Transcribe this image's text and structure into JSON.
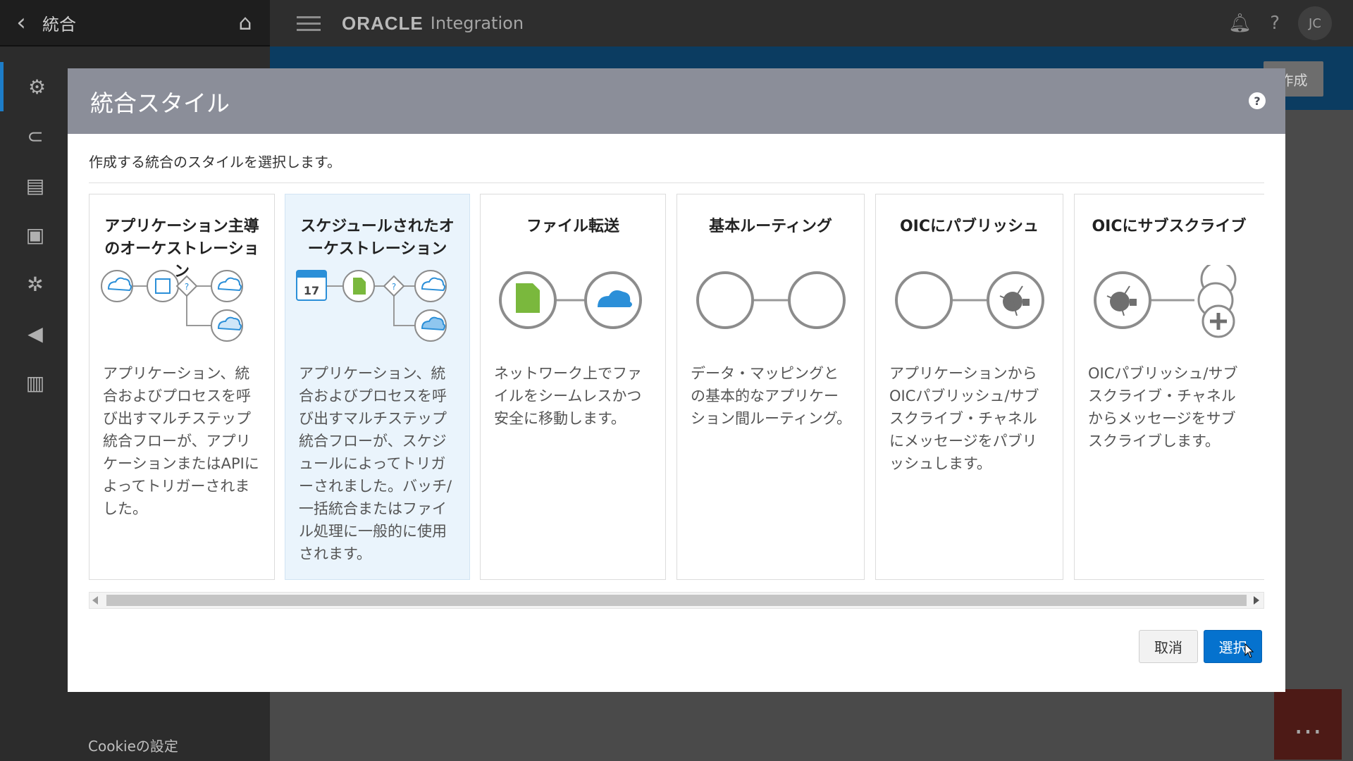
{
  "sidebar": {
    "title": "統合",
    "back_icon": "chevron-left-icon",
    "home_icon": "home-icon",
    "cookie_settings": "Cookieの設定"
  },
  "topbar": {
    "brand": "ORACLE",
    "product": "Integration",
    "avatar_initials": "JC"
  },
  "page": {
    "create_label": "作成"
  },
  "modal": {
    "title": "統合スタイル",
    "help_label": "?",
    "subtitle": "作成する統合のスタイルを選択します。",
    "cancel_label": "取消",
    "select_label": "選択",
    "selected_index": 1,
    "cards": [
      {
        "title": "アプリケーション主導のオーケストレーション",
        "desc": "アプリケーション、統合およびプロセスを呼び出すマルチステップ統合フローが、アプリケーションまたはAPIによってトリガーされました。"
      },
      {
        "title": "スケジュールされたオーケストレーション",
        "desc": "アプリケーション、統合およびプロセスを呼び出すマルチステップ統合フローが、スケジュールによってトリガーされました。バッチ/一括統合またはファイル処理に一般的に使用されます。"
      },
      {
        "title": "ファイル転送",
        "desc": "ネットワーク上でファイルをシームレスかつ安全に移動します。"
      },
      {
        "title": "基本ルーティング",
        "desc": "データ・マッピングとの基本的なアプリケーション間ルーティング。"
      },
      {
        "title": "OICにパブリッシュ",
        "desc": "アプリケーションからOICパブリッシュ/サブスクライブ・チャネルにメッセージをパブリッシュします。"
      },
      {
        "title": "OICにサブスクライブ",
        "desc": "OICパブリッシュ/サブスクライブ・チャネルからメッセージをサブスクライブします。"
      }
    ]
  },
  "colors": {
    "accent": "#0572ce",
    "selected_card_bg": "#eaf4fc",
    "header_bg": "#8b8e99"
  }
}
